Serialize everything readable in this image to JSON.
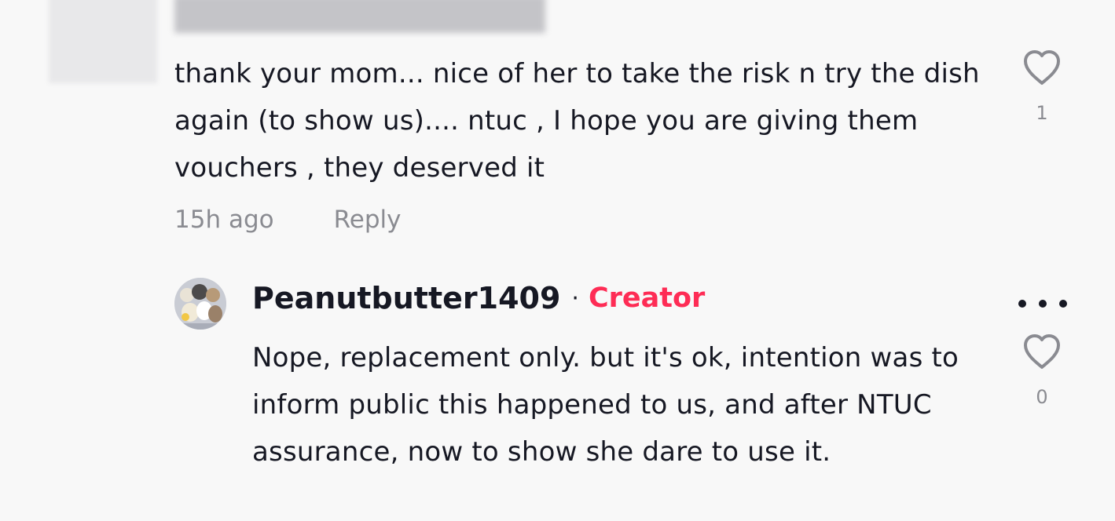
{
  "comment": {
    "text": "thank your mom... nice of her to take the risk n try the dish again (to show us).... ntuc , I hope you are giving them vouchers , they deserved it",
    "time": "15h ago",
    "reply_label": "Reply",
    "like_count": "1",
    "like_icon": "heart-outline-icon"
  },
  "reply": {
    "username": "Peanutbutter1409",
    "separator": "·",
    "badge": "Creator",
    "text": "Nope, replacement only. but it's ok, intention was to inform public this happened to us, and after NTUC assurance, now to show she dare to use it.",
    "like_count": "0",
    "like_icon": "heart-outline-icon",
    "more_icon": "more-horizontal-icon"
  },
  "colors": {
    "background": "#f8f8f8",
    "text": "#161823",
    "muted": "#8a8b91",
    "creator_accent": "#fe2c55"
  }
}
